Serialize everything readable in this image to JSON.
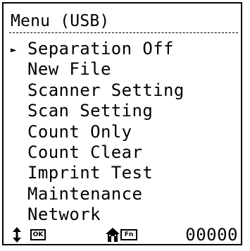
{
  "screen": {
    "title": "Menu (USB)",
    "menu_items": [
      {
        "label": "Separation Off",
        "selected": true
      },
      {
        "label": "New File",
        "selected": false
      },
      {
        "label": "Scanner Setting",
        "selected": false
      },
      {
        "label": "Scan Setting",
        "selected": false
      },
      {
        "label": "Count Only",
        "selected": false
      },
      {
        "label": "Count Clear",
        "selected": false
      },
      {
        "label": "Imprint Test",
        "selected": false
      },
      {
        "label": "Maintenance",
        "selected": false
      },
      {
        "label": "Network",
        "selected": false
      }
    ],
    "cursor_glyph": "►"
  },
  "status_bar": {
    "icons": [
      "up-down-arrow-icon",
      "ok-key-icon",
      "home-icon",
      "fn-key-icon"
    ],
    "ok_label": "OK",
    "fn_label": "Fn",
    "counter": "00000"
  }
}
